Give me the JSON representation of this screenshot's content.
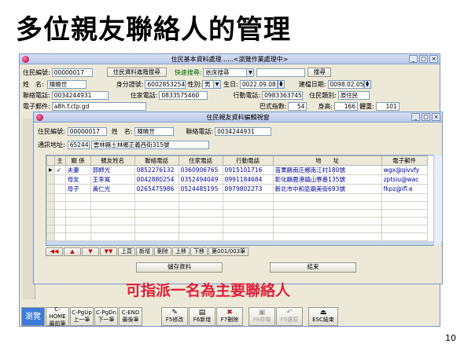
{
  "slide": {
    "title": "多位親友聯絡人的管理",
    "page_number": "10",
    "annotation": "可指派一名為主要聯絡人"
  },
  "main_window": {
    "title": "住民基本資料處理......<瀏覽作業處理中>",
    "resident_id_label": "住民編號:",
    "resident_id": "00000017",
    "advanced_search_button": "住民資料進階搜尋",
    "quick_search_label": "快速搜尋:",
    "quick_search_select": "依床搜尋",
    "search_button": "搜尋",
    "name_label": "姓　名:",
    "name": "陳曉世",
    "id_label": "身分證號:",
    "id_number": "6002853254",
    "gender_label": "性別:",
    "gender": "男",
    "birthday_label": "生日:",
    "birthday": "0022.09.08",
    "intake_label": "建檔日期:",
    "intake_date": "0098.02.05",
    "contact_phone_label": "聯絡電話:",
    "contact_phone": "0034244931",
    "home_phone_label": "住家電話:",
    "home_phone": "0833575460",
    "mobile_label": "行動電話:",
    "mobile": "0983363745",
    "category_label": "住民類別:",
    "category": "原住民",
    "email_label": "電子郵件:",
    "email": "a8h.f.ctp.gd",
    "adl_label": "巴式指數:",
    "adl": "54",
    "height_label": "身高:",
    "height": "166",
    "weight_label": "體重:",
    "weight": "101"
  },
  "dialog": {
    "title": "住民親友資料編輯視窗",
    "resident_id_label": "住民編號:",
    "resident_id": "00000017",
    "name_label": "姓　名:",
    "name": "陳曉世",
    "contact_phone_label": "聯絡電話:",
    "contact_phone": "0034244931",
    "address_label": "通訊地址:",
    "zip": "65244",
    "address": "雲林縣土林鄉正義西街315號",
    "columns": [
      "主",
      "關 係",
      "親友姓名",
      "聯絡電話",
      "住家電話",
      "行動電話",
      "地　　址",
      "電子郵件"
    ],
    "rows": [
      {
        "main": "✓",
        "relation": "夫妻",
        "name": "郭師光",
        "contact": "0852276132",
        "home": "0360906765",
        "mobile": "0915101716",
        "address": "苗栗縣南庄鄉南江村180號",
        "email": "wgx@qivvfy"
      },
      {
        "main": "",
        "relation": "母女",
        "name": "王李寬",
        "contact": "0042880254",
        "home": "0352494049",
        "mobile": "0991184684",
        "address": "彰化縣鹿港鎮山寮巷135號",
        "email": "zptsiu@wac"
      },
      {
        "main": "",
        "relation": "母子",
        "name": "黃仁光",
        "contact": "0265475986",
        "home": "0524485195",
        "mobile": "0979802273",
        "address": "新北市中和區廟美街693號",
        "email": "fkpz@ifl.e"
      }
    ],
    "nav": [
      "上頁",
      "新增",
      "刪除",
      "上移",
      "下移"
    ],
    "record_indicator": "第001/003筆",
    "save_button": "儲存資料",
    "close_button": "結束"
  },
  "function_keys": [
    {
      "line1": "瀏覽",
      "line2": ""
    },
    {
      "line1": "C-HOME",
      "line2": "最前筆"
    },
    {
      "line1": "C-PgUp",
      "line2": "上一筆"
    },
    {
      "line1": "C-PgDn",
      "line2": "下一筆"
    },
    {
      "line1": "C-END",
      "line2": "最後筆"
    },
    {
      "line1": "F5修改",
      "line2": ""
    },
    {
      "line1": "F6新增",
      "line2": ""
    },
    {
      "line1": "F7刪除",
      "line2": ""
    },
    {
      "line1": "F8存檔",
      "line2": ""
    },
    {
      "line1": "F9還原",
      "line2": ""
    },
    {
      "line1": "ESC結束",
      "line2": ""
    }
  ]
}
